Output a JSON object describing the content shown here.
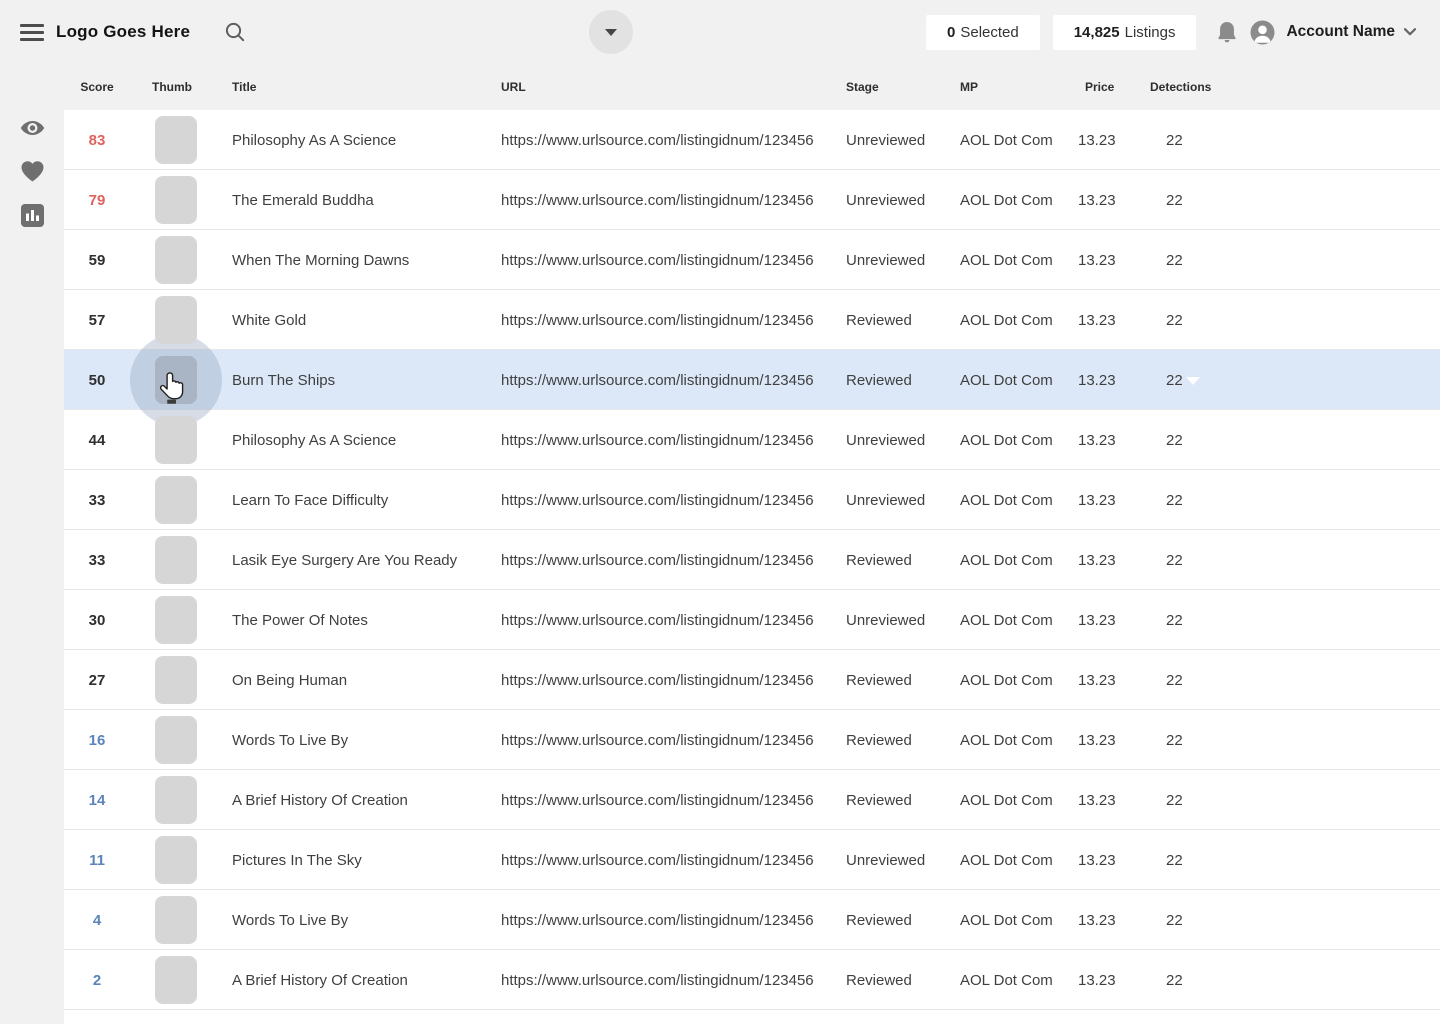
{
  "topbar": {
    "logo_text": "Logo Goes Here",
    "selected": {
      "count": "0",
      "label": "Selected"
    },
    "listings": {
      "count": "14,825",
      "label": "Listings"
    },
    "account_name": "Account Name",
    "icons": [
      "hamburger-icon",
      "search-icon",
      "chevron-down-icon",
      "bell-icon",
      "user-avatar-icon",
      "chevron-down-icon"
    ]
  },
  "sidebar": {
    "items": [
      {
        "icon": "eye-icon"
      },
      {
        "icon": "heart-icon"
      },
      {
        "icon": "stats-icon"
      }
    ]
  },
  "table": {
    "columns": [
      "Score",
      "Thumb",
      "Title",
      "URL",
      "Stage",
      "MP",
      "Price",
      "Detections"
    ],
    "rows": [
      {
        "score": "83",
        "tier": "high",
        "title": "Philosophy As A Science",
        "url": "https://www.urlsource.com/listingidnum/123456",
        "stage": "Unreviewed",
        "mp": "AOL Dot Com",
        "price": "13.23",
        "detections": "22",
        "highlighted": false
      },
      {
        "score": "79",
        "tier": "high",
        "title": "The Emerald Buddha",
        "url": "https://www.urlsource.com/listingidnum/123456",
        "stage": "Unreviewed",
        "mp": "AOL Dot Com",
        "price": "13.23",
        "detections": "22",
        "highlighted": false
      },
      {
        "score": "59",
        "tier": "mid",
        "title": "When The Morning Dawns",
        "url": "https://www.urlsource.com/listingidnum/123456",
        "stage": "Unreviewed",
        "mp": "AOL Dot Com",
        "price": "13.23",
        "detections": "22",
        "highlighted": false
      },
      {
        "score": "57",
        "tier": "mid",
        "title": "White Gold",
        "url": "https://www.urlsource.com/listingidnum/123456",
        "stage": "Reviewed",
        "mp": "AOL Dot Com",
        "price": "13.23",
        "detections": "22",
        "highlighted": false
      },
      {
        "score": "50",
        "tier": "mid",
        "title": "Burn The Ships",
        "url": "https://www.urlsource.com/listingidnum/123456",
        "stage": "Reviewed",
        "mp": "AOL Dot Com",
        "price": "13.23",
        "detections": "22",
        "highlighted": true
      },
      {
        "score": "44",
        "tier": "mid",
        "title": "Philosophy As A Science",
        "url": "https://www.urlsource.com/listingidnum/123456",
        "stage": "Unreviewed",
        "mp": "AOL Dot Com",
        "price": "13.23",
        "detections": "22",
        "highlighted": false
      },
      {
        "score": "33",
        "tier": "mid",
        "title": "Learn To Face Difficulty",
        "url": "https://www.urlsource.com/listingidnum/123456",
        "stage": "Unreviewed",
        "mp": "AOL Dot Com",
        "price": "13.23",
        "detections": "22",
        "highlighted": false
      },
      {
        "score": "33",
        "tier": "mid",
        "title": "Lasik Eye Surgery Are You Ready",
        "url": "https://www.urlsource.com/listingidnum/123456",
        "stage": "Reviewed",
        "mp": "AOL Dot Com",
        "price": "13.23",
        "detections": "22",
        "highlighted": false
      },
      {
        "score": "30",
        "tier": "mid",
        "title": "The Power Of Notes",
        "url": "https://www.urlsource.com/listingidnum/123456",
        "stage": "Unreviewed",
        "mp": "AOL Dot Com",
        "price": "13.23",
        "detections": "22",
        "highlighted": false
      },
      {
        "score": "27",
        "tier": "mid",
        "title": "On Being Human",
        "url": "https://www.urlsource.com/listingidnum/123456",
        "stage": "Reviewed",
        "mp": "AOL Dot Com",
        "price": "13.23",
        "detections": "22",
        "highlighted": false
      },
      {
        "score": "16",
        "tier": "low",
        "title": "Words To Live By",
        "url": "https://www.urlsource.com/listingidnum/123456",
        "stage": "Reviewed",
        "mp": "AOL Dot Com",
        "price": "13.23",
        "detections": "22",
        "highlighted": false
      },
      {
        "score": "14",
        "tier": "low",
        "title": "A Brief History Of Creation",
        "url": "https://www.urlsource.com/listingidnum/123456",
        "stage": "Reviewed",
        "mp": "AOL Dot Com",
        "price": "13.23",
        "detections": "22",
        "highlighted": false
      },
      {
        "score": "11",
        "tier": "low",
        "title": "Pictures In The Sky",
        "url": "https://www.urlsource.com/listingidnum/123456",
        "stage": "Unreviewed",
        "mp": "AOL Dot Com",
        "price": "13.23",
        "detections": "22",
        "highlighted": false
      },
      {
        "score": "4",
        "tier": "low",
        "title": "Words To Live By",
        "url": "https://www.urlsource.com/listingidnum/123456",
        "stage": "Reviewed",
        "mp": "AOL Dot Com",
        "price": "13.23",
        "detections": "22",
        "highlighted": false
      },
      {
        "score": "2",
        "tier": "low",
        "title": "A Brief History Of Creation",
        "url": "https://www.urlsource.com/listingidnum/123456",
        "stage": "Reviewed",
        "mp": "AOL Dot Com",
        "price": "13.23",
        "detections": "22",
        "highlighted": false
      }
    ]
  },
  "colors": {
    "score_high": "#de635e",
    "score_mid": "#2f2f2f",
    "score_low": "#5b84bb",
    "row_highlight": "#dce8f8",
    "topbar_bg": "#f1f1f1",
    "icon_gray": "#6f6f6f"
  }
}
